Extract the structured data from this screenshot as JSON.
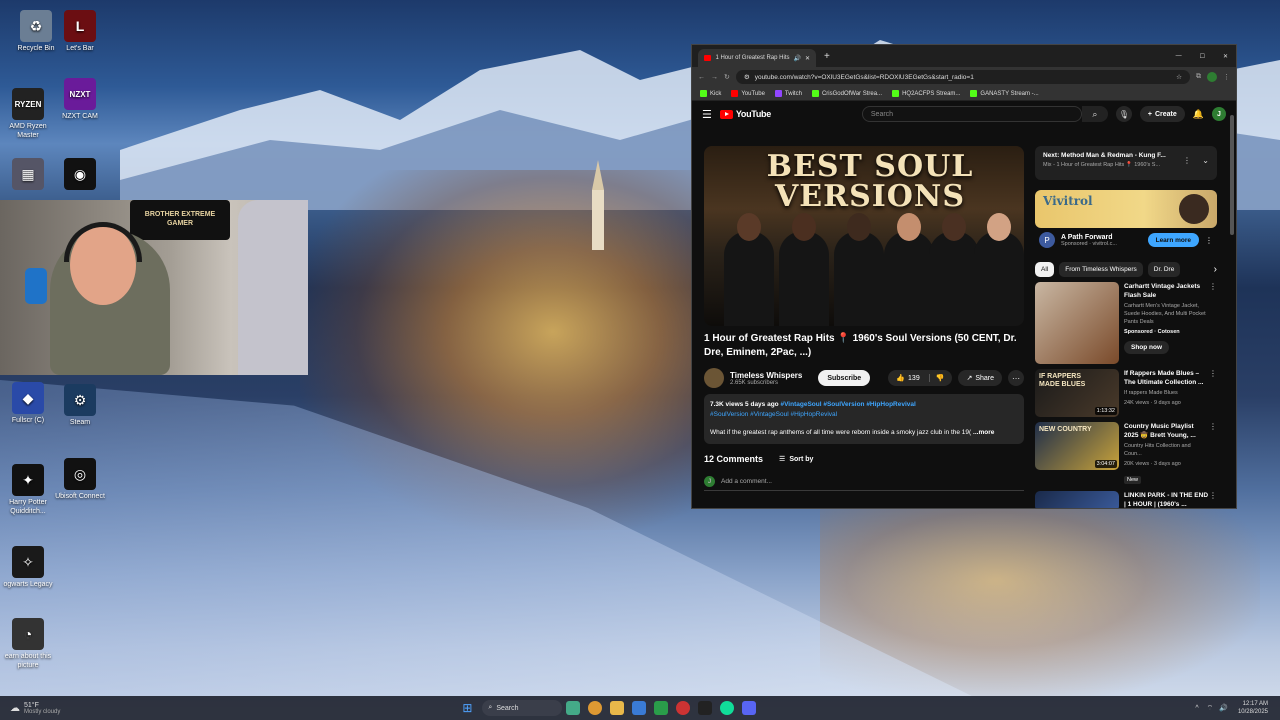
{
  "desktop": {
    "icons": [
      {
        "label": "Recycle Bin",
        "glyph": "♻",
        "color": "#6b7e94"
      },
      {
        "label": "Let's Bar",
        "glyph": "L",
        "color": "#6b0e12"
      },
      {
        "label": "AMD Ryzen Master",
        "glyph": "RYZEN",
        "color": "#222"
      },
      {
        "label": "NZXT CAM",
        "glyph": "NZXT",
        "color": "#6a1b9a"
      },
      {
        "label": "",
        "glyph": "▦",
        "color": "#556"
      },
      {
        "label": "",
        "glyph": "◉",
        "color": "#111"
      },
      {
        "label": "Fullscr (C)",
        "glyph": "◆",
        "color": "#2a4aa8"
      },
      {
        "label": "Steam",
        "glyph": "⚙",
        "color": "#1b3b60"
      },
      {
        "label": "Harry Potter Quidditch...",
        "glyph": "✦",
        "color": "#111"
      },
      {
        "label": "Ubisoft Connect",
        "glyph": "◎",
        "color": "#111"
      },
      {
        "label": "ogwarts Legacy",
        "glyph": "✧",
        "color": "#1a1a1a"
      },
      {
        "label": "earn about this picture",
        "glyph": "◔",
        "color": "#333"
      }
    ],
    "webcam_sign": "BROTHER EXTREME GAMER"
  },
  "browser": {
    "tab_title": "1 Hour of Greatest Rap Hits",
    "url": "youtube.com/watch?v=OXlU3EGetGs&list=RDOXlU3EGetGs&start_radio=1",
    "bookmarks": [
      "Kick",
      "YouTube",
      "Twitch",
      "CrisGodOfWar Strea...",
      "HQ2ACFPS Stream...",
      "GANASTY Stream -..."
    ]
  },
  "youtube": {
    "logo": "YouTube",
    "search_placeholder": "Search",
    "create_label": "Create",
    "avatar_letter": "J",
    "video_overlay_line1": "BEST SOUL",
    "video_overlay_line2": "VERSIONS",
    "title": "1 Hour of Greatest Rap Hits 📍 1960's Soul Versions (50 CENT, Dr. Dre, Eminem, 2Pac, ...)",
    "channel": "Timeless Whispers",
    "subscribers": "2.65K subscribers",
    "subscribe_label": "Subscribe",
    "likes": "139",
    "share_label": "Share",
    "views_date": "7.3K views  5 days ago",
    "tags_line1": "#VintageSoul #SoulVersion #HipHopRevival",
    "tags_line2": "#SoulVersion #VintageSoul #HipHopRevival",
    "description": "What if the greatest rap anthems of all time were reborn inside a smoky jazz club in the 19(",
    "more_label": "...more",
    "comments_count": "12 Comments",
    "sort_label": "Sort by",
    "add_comment": "Add a comment...",
    "next_title": "Next: Method Man & Redman - Kung F...",
    "next_sub": "Mix - 1 Hour of Greatest Rap Hits 📍 1960's S...",
    "ad_brand": "Vivitrol",
    "ad_title": "A Path Forward",
    "ad_meta": "Sponsored · vivitrol.c...",
    "ad_button": "Learn more",
    "chips": [
      "All",
      "From Timeless Whispers",
      "Dr. Dre"
    ],
    "recs": [
      {
        "title": "Carhartt Vintage Jackets Flash Sale",
        "meta1": "Carhartt Men's Vintage Jacket, Suede Hoodies, And Multi Pocket Pants Deals",
        "meta2": "Sponsored · Cotosen",
        "button": "Shop now",
        "duration": ""
      },
      {
        "title": "If Rappers Made Blues – The Ultimate Collection ...",
        "meta1": "If rappers Made Blues",
        "meta2": "24K views · 9 days ago",
        "duration": "1:13:32",
        "thumb_text": "IF RAPPERS MADE BLUES"
      },
      {
        "title": "Country Music Playlist 2025 🤠 Brett Young, ...",
        "meta1": "Country Hits Collection and Coun...",
        "meta2": "20K views · 3 days ago",
        "badge": "New",
        "duration": "3:04:07",
        "thumb_text": "NEW COUNTRY"
      },
      {
        "title": "LINKIN PARK - IN THE END | 1 HOUR | (1960's ...",
        "meta1": "",
        "meta2": "",
        "duration": ""
      }
    ]
  },
  "taskbar": {
    "weather_temp": "51°F",
    "weather_desc": "Mostly cloudy",
    "search": "Search",
    "time": "12:17 AM",
    "date": "10/28/2025"
  }
}
